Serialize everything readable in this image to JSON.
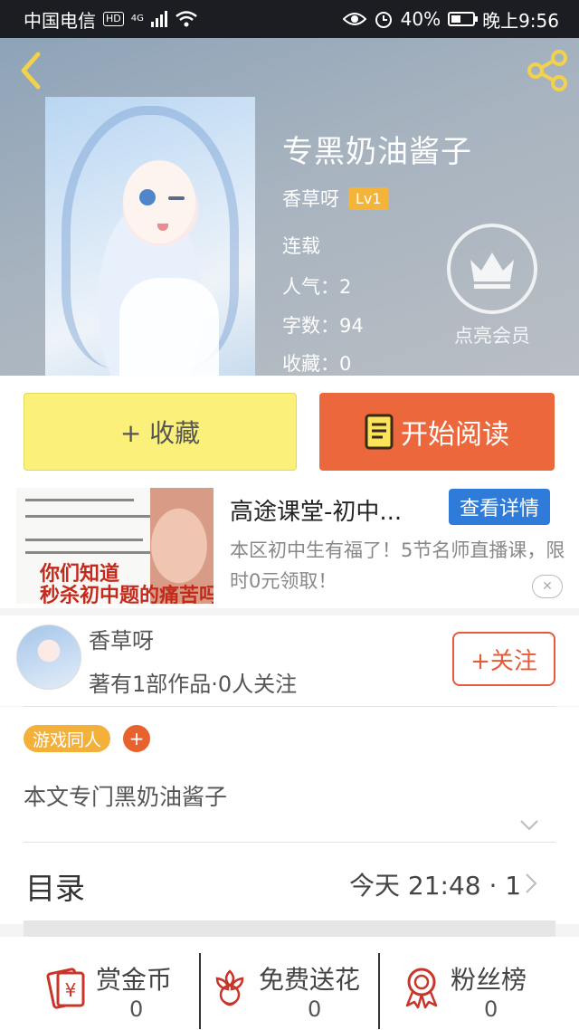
{
  "status_bar": {
    "carrier": "中国电信",
    "network": "4G",
    "battery": "40%",
    "time": "晚上9:56"
  },
  "book": {
    "title": "专黑奶油酱子",
    "author": "香草呀",
    "level": "Lv1",
    "status": "连载",
    "popularity": "人气：2",
    "word_count": "字数：94",
    "favorites": "收藏：0",
    "vip_label": "点亮会员"
  },
  "actions": {
    "collect_label": "+ 收藏",
    "read_label": "开始阅读"
  },
  "ad": {
    "title": "高途课堂-初中...",
    "detail_button": "查看详情",
    "description": "本区初中生有福了！5节名师直播课，限时0元领取！",
    "image_caption": "你们知道\n秒杀初中题的痛苦吗"
  },
  "author_section": {
    "name": "香草呀",
    "info": "著有1部作品·0人关注",
    "follow_label": "+关注"
  },
  "tags": [
    "游戏同人"
  ],
  "description": "本文专门黑奶油酱子",
  "catalog": {
    "title": "目录",
    "update": "今天 21:48 · 1"
  },
  "stats": [
    {
      "label": "赏金币",
      "value": "0"
    },
    {
      "label": "免费送花",
      "value": "0"
    },
    {
      "label": "粉丝榜",
      "value": "0"
    }
  ],
  "colors": {
    "accent_orange": "#ec673b",
    "collect_yellow": "#fbf07a",
    "tag_orange": "#f3b13c",
    "ad_blue": "#2f7bd9"
  }
}
